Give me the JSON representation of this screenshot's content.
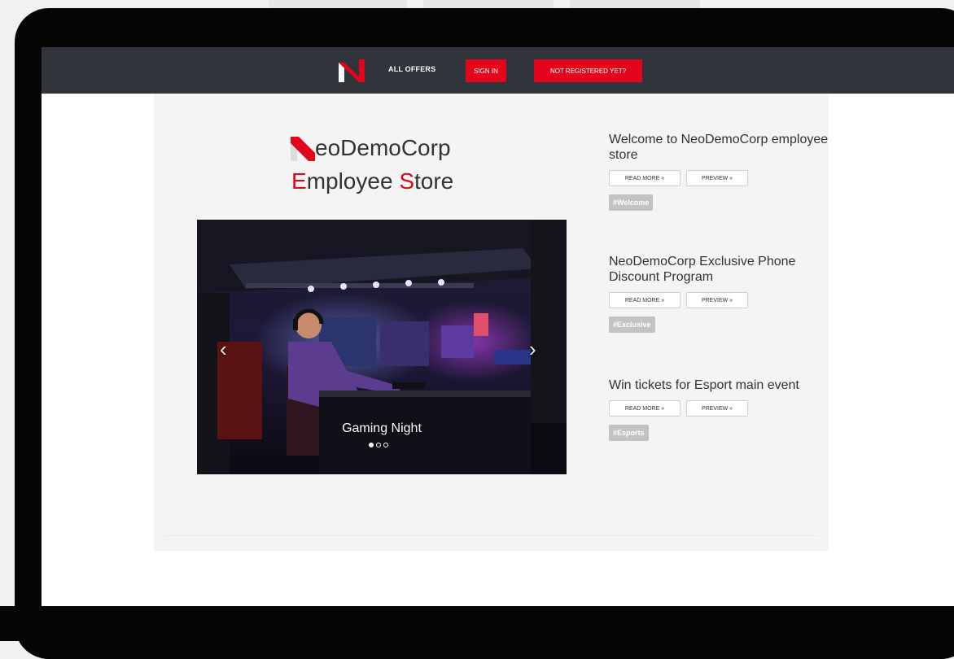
{
  "navbar": {
    "logo_icon": "brand-n-logo",
    "all_offers": "ALL OFFERS",
    "sign_in": "SIGN IN",
    "register": "NOT REGISTERED YET?"
  },
  "brand": {
    "line1": "eoDemoCorp",
    "line2_e": "E",
    "line2_mid": "mployee ",
    "line2_s": "S",
    "line2_end": "tore"
  },
  "carousel": {
    "caption": "Gaming Night",
    "slides_total": 3,
    "active_slide": 1,
    "prev_icon": "chevron-left-icon",
    "next_icon": "chevron-right-icon"
  },
  "offers": [
    {
      "title": "Welcome to NeoDemoCorp employee store",
      "read_more": "READ MORE »",
      "preview": "PREVIEW »",
      "tag": "#Welcome"
    },
    {
      "title": "NeoDemoCorp Exclusive Phone Discount Program",
      "read_more": "READ MORE »",
      "preview": "PREVIEW »",
      "tag": "#Exclusive"
    },
    {
      "title": "Win tickets for Esport main event",
      "read_more": "READ MORE »",
      "preview": "PREVIEW »",
      "tag": "#Esports"
    }
  ],
  "colors": {
    "accent": "#e3051b",
    "navbar": "#2f353b",
    "content_bg": "#f4f4f4",
    "tag_bg": "#c3c3c3"
  }
}
